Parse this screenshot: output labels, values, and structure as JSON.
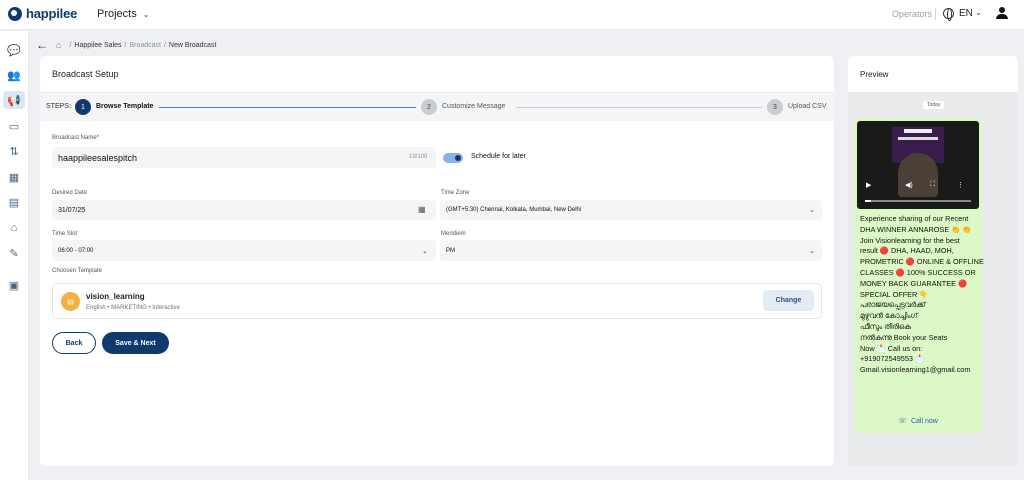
{
  "app": {
    "name": "happilee"
  },
  "topbar": {
    "projects_label": "Projects",
    "operators_label": "Operators",
    "language": "EN"
  },
  "sidebar": {
    "items": [
      {
        "name": "chat-icon",
        "glyph": "💬",
        "active": false
      },
      {
        "name": "contacts-icon",
        "glyph": "👥",
        "active": false
      },
      {
        "name": "broadcast-icon",
        "glyph": "📢",
        "active": true
      },
      {
        "name": "briefcase-icon",
        "glyph": "▭",
        "active": false
      },
      {
        "name": "flows-icon",
        "glyph": "⇅",
        "active": false
      },
      {
        "name": "calendar-icon",
        "glyph": "▦",
        "active": false
      },
      {
        "name": "document-icon",
        "glyph": "▤",
        "active": false
      },
      {
        "name": "tag-icon",
        "glyph": "⌂",
        "active": false
      },
      {
        "name": "tools-icon",
        "glyph": "✎",
        "active": false
      },
      {
        "name": "bag-icon",
        "glyph": "▣",
        "active": false
      }
    ]
  },
  "breadcrumb": {
    "items": [
      "Happilee Sales",
      "Broadcast",
      "New Broadcast"
    ]
  },
  "form": {
    "title": "Broadcast Setup",
    "steps_label": "STEPS:",
    "steps": [
      {
        "number": "1",
        "label": "Browse Template",
        "active": true
      },
      {
        "number": "2",
        "label": "Customize Message",
        "active": false
      },
      {
        "number": "3",
        "label": "Upload CSV",
        "active": false
      }
    ],
    "broadcast_name_label": "Broadcast Name*",
    "broadcast_name_value": "haappileesalespitch",
    "broadcast_name_counter": "19/100",
    "schedule_label": "Schedule for later",
    "schedule_enabled": true,
    "date_label": "Desired Date",
    "date_value": "31/07/25",
    "timezone_label": "Time Zone",
    "timezone_value": "(GMT+5:30) Chennai, Kolkata, Mumbai, New Delhi",
    "timeslot_label": "Time Slot",
    "timeslot_value": "06:00 - 07:00",
    "meridiem_label": "Meridiem",
    "meridiem_value": "PM",
    "template_label": "Choosen Template",
    "template_name": "vision_learning",
    "template_meta": "English • MARKETING • Interactive",
    "change_label": "Change",
    "back_label": "Back",
    "next_label": "Save & Next"
  },
  "preview": {
    "title": "Preview",
    "date_chip": "Today",
    "message_lines": [
      "Experience sharing of our Recent",
      "DHA WINNER ANNAROSE 👏 👏",
      "Join Visionlearning for the best",
      "result 🔴 DHA, HAAD, MOH,",
      "PROMETRIC 🔴 ONLINE & OFFLINE",
      "CLASSES 🔴 100% SUCCESS OR",
      "MONEY BACK GUARANTEE 🔴",
      "SPECIAL OFFER 👇",
      "പരാജയപ്പെട്ടവർക്ക്",
      "മുഴുവൻ കോച്ചിംഗ്",
      "ഫീസും തിരികെ",
      "നൽകുന്നു Book your Seats",
      "Now 📩 Call us on:",
      "+919072549553 📩",
      "Gmail.visionlearning1@gmail.com"
    ],
    "call_button_label": "Call now"
  },
  "colors": {
    "brand": "#0f3a6b",
    "accent_light": "#dbe6f3",
    "bubble": "#dcf8c6"
  }
}
